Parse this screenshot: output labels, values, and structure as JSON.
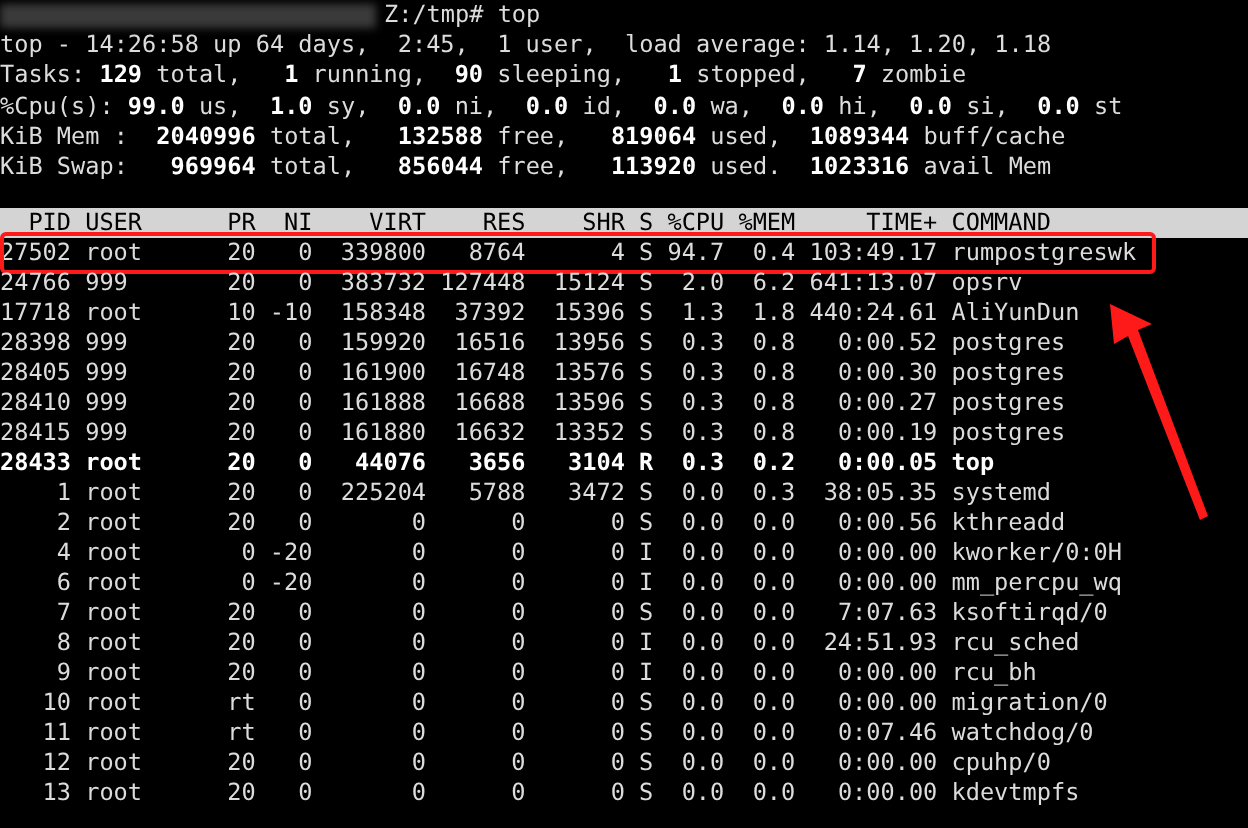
{
  "prompt": {
    "redacted": true,
    "text": "Z:/tmp# top"
  },
  "summary": [
    "top - 14:26:58 up 64 days,  2:45,  1 user,  load average: 1.14, 1.20, 1.18",
    "Tasks: **129** total,   **1** running,  **90** sleeping,   **1** stopped,   **7** zombie",
    "%Cpu(s): **99.0** us,  **1.0** sy,  **0.0** ni,  **0.0** id,  **0.0** wa,  **0.0** hi,  **0.0** si,  **0.0** st",
    "KiB Mem :  **2040996** total,   **132588** free,   **819064** used,  **1089344** buff/cache",
    "KiB Swap:   **969964** total,   **856044** free,   **113920** used.  **1023316** avail Mem"
  ],
  "table": {
    "columns": [
      "PID",
      "USER",
      "PR",
      "NI",
      "VIRT",
      "RES",
      "SHR",
      "S",
      "%CPU",
      "%MEM",
      "TIME+",
      "COMMAND"
    ],
    "rows": [
      {
        "cells": [
          "27502",
          "root",
          "20",
          "0",
          "339800",
          "8764",
          "4",
          "S",
          "94.7",
          "0.4",
          "103:49.17",
          "rumpostgreswk"
        ],
        "bold": false,
        "highlighted": true
      },
      {
        "cells": [
          "24766",
          "999",
          "20",
          "0",
          "383732",
          "127448",
          "15124",
          "S",
          "2.0",
          "6.2",
          "641:13.07",
          "opsrv"
        ],
        "bold": false,
        "highlighted": false
      },
      {
        "cells": [
          "17718",
          "root",
          "10",
          "-10",
          "158348",
          "37392",
          "15396",
          "S",
          "1.3",
          "1.8",
          "440:24.61",
          "AliYunDun"
        ],
        "bold": false,
        "highlighted": false
      },
      {
        "cells": [
          "28398",
          "999",
          "20",
          "0",
          "159920",
          "16516",
          "13956",
          "S",
          "0.3",
          "0.8",
          "0:00.52",
          "postgres"
        ],
        "bold": false,
        "highlighted": false
      },
      {
        "cells": [
          "28405",
          "999",
          "20",
          "0",
          "161900",
          "16748",
          "13576",
          "S",
          "0.3",
          "0.8",
          "0:00.30",
          "postgres"
        ],
        "bold": false,
        "highlighted": false
      },
      {
        "cells": [
          "28410",
          "999",
          "20",
          "0",
          "161888",
          "16688",
          "13596",
          "S",
          "0.3",
          "0.8",
          "0:00.27",
          "postgres"
        ],
        "bold": false,
        "highlighted": false
      },
      {
        "cells": [
          "28415",
          "999",
          "20",
          "0",
          "161880",
          "16632",
          "13352",
          "S",
          "0.3",
          "0.8",
          "0:00.19",
          "postgres"
        ],
        "bold": false,
        "highlighted": false
      },
      {
        "cells": [
          "28433",
          "root",
          "20",
          "0",
          "44076",
          "3656",
          "3104",
          "R",
          "0.3",
          "0.2",
          "0:00.05",
          "top"
        ],
        "bold": true,
        "highlighted": false
      },
      {
        "cells": [
          "1",
          "root",
          "20",
          "0",
          "225204",
          "5788",
          "3472",
          "S",
          "0.0",
          "0.3",
          "38:05.35",
          "systemd"
        ],
        "bold": false,
        "highlighted": false
      },
      {
        "cells": [
          "2",
          "root",
          "20",
          "0",
          "0",
          "0",
          "0",
          "S",
          "0.0",
          "0.0",
          "0:00.56",
          "kthreadd"
        ],
        "bold": false,
        "highlighted": false
      },
      {
        "cells": [
          "4",
          "root",
          "0",
          "-20",
          "0",
          "0",
          "0",
          "I",
          "0.0",
          "0.0",
          "0:00.00",
          "kworker/0:0H"
        ],
        "bold": false,
        "highlighted": false
      },
      {
        "cells": [
          "6",
          "root",
          "0",
          "-20",
          "0",
          "0",
          "0",
          "I",
          "0.0",
          "0.0",
          "0:00.00",
          "mm_percpu_wq"
        ],
        "bold": false,
        "highlighted": false
      },
      {
        "cells": [
          "7",
          "root",
          "20",
          "0",
          "0",
          "0",
          "0",
          "S",
          "0.0",
          "0.0",
          "7:07.63",
          "ksoftirqd/0"
        ],
        "bold": false,
        "highlighted": false
      },
      {
        "cells": [
          "8",
          "root",
          "20",
          "0",
          "0",
          "0",
          "0",
          "I",
          "0.0",
          "0.0",
          "24:51.93",
          "rcu_sched"
        ],
        "bold": false,
        "highlighted": false
      },
      {
        "cells": [
          "9",
          "root",
          "20",
          "0",
          "0",
          "0",
          "0",
          "I",
          "0.0",
          "0.0",
          "0:00.00",
          "rcu_bh"
        ],
        "bold": false,
        "highlighted": false
      },
      {
        "cells": [
          "10",
          "root",
          "rt",
          "0",
          "0",
          "0",
          "0",
          "S",
          "0.0",
          "0.0",
          "0:00.00",
          "migration/0"
        ],
        "bold": false,
        "highlighted": false
      },
      {
        "cells": [
          "11",
          "root",
          "rt",
          "0",
          "0",
          "0",
          "0",
          "S",
          "0.0",
          "0.0",
          "0:07.46",
          "watchdog/0"
        ],
        "bold": false,
        "highlighted": false
      },
      {
        "cells": [
          "12",
          "root",
          "20",
          "0",
          "0",
          "0",
          "0",
          "S",
          "0.0",
          "0.0",
          "0:00.00",
          "cpuhp/0"
        ],
        "bold": false,
        "highlighted": false
      },
      {
        "cells": [
          "13",
          "root",
          "20",
          "0",
          "0",
          "0",
          "0",
          "S",
          "0.0",
          "0.0",
          "0:00.00",
          "kdevtmpfs"
        ],
        "bold": false,
        "highlighted": false
      }
    ]
  }
}
